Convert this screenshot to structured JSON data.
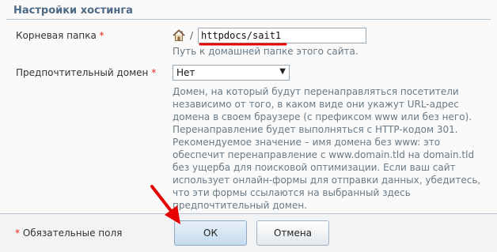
{
  "section": {
    "title": "Настройки хостинга"
  },
  "root_folder": {
    "label": "Корневая папка",
    "required_mark": "*",
    "separator": "/",
    "value": "httpdocs/sait1",
    "hint": "Путь к домашней папке этого сайта."
  },
  "preferred_domain": {
    "label": "Предпочтительный домен",
    "required_mark": "*",
    "selected": "Нет",
    "description": "Домен, на который будут перенаправляться посетители независимо от того, в каком виде они укажут URL-адрес домена в своем браузере (с префиксом www или без него). Перенаправление будет выполняться с HTTP-кодом 301. Рекомендуемое значение – имя домена без www: это обеспечит перенаправление с www.domain.tld на domain.tld без ущерба для поисковой оптимизации. Если ваш сайт использует онлайн-формы для отправки данных, убедитесь, что эти формы ссылаются на выбранный здесь предпочтительный домен."
  },
  "footer": {
    "required_mark": "*",
    "required_note": "Обязательные поля",
    "ok_label": "ОК",
    "cancel_label": "Отмена"
  },
  "colors": {
    "accent": "#4d6a86",
    "annotation": "#e60000"
  }
}
